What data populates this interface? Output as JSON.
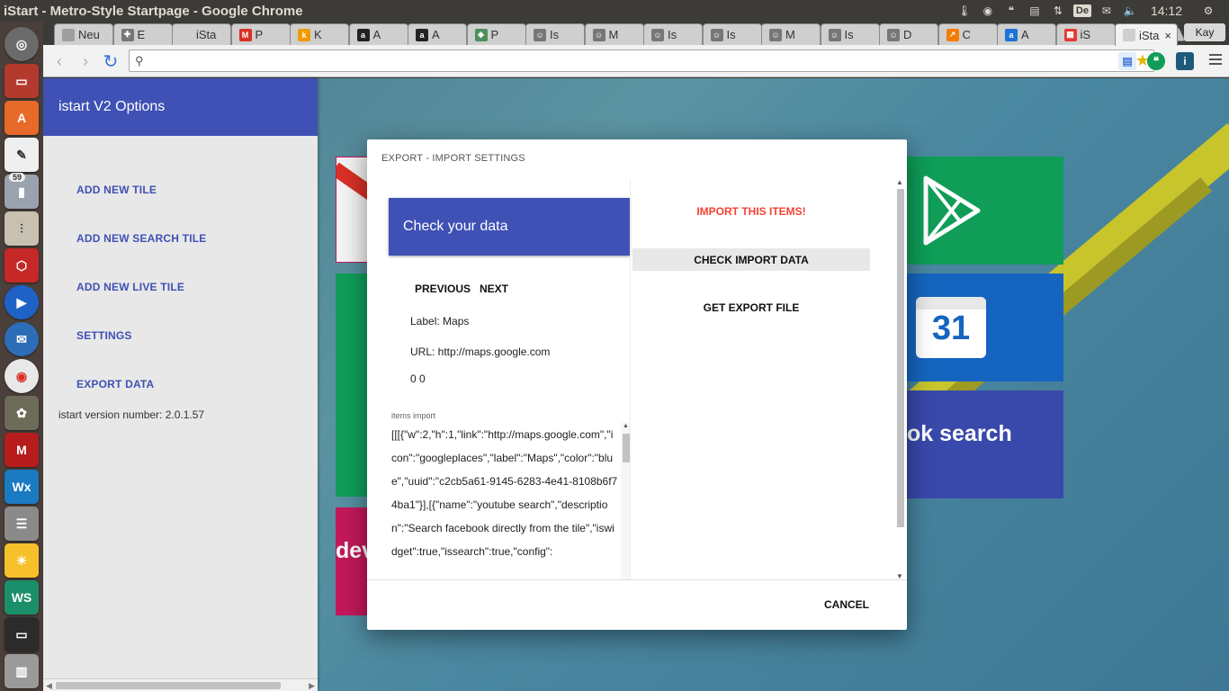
{
  "window": {
    "title": "iStart - Metro-Style Startpage - Google Chrome"
  },
  "tray": {
    "keyboard": "De",
    "time": "14:12"
  },
  "launcher": {
    "badge": "59"
  },
  "tabs": [
    {
      "label": "Neu",
      "fav_color": "#9e9e9e",
      "fav_glyph": ""
    },
    {
      "label": "E",
      "fav_color": "#777777",
      "fav_glyph": "✚"
    },
    {
      "label": "iSta",
      "fav_color": "#cfcfcf",
      "fav_glyph": ""
    },
    {
      "label": "P",
      "fav_color": "#d93025",
      "fav_glyph": "M"
    },
    {
      "label": "K",
      "fav_color": "#f29a00",
      "fav_glyph": "k"
    },
    {
      "label": "A",
      "fav_color": "#222222",
      "fav_glyph": "a"
    },
    {
      "label": "A",
      "fav_color": "#222222",
      "fav_glyph": "a"
    },
    {
      "label": "P",
      "fav_color": "#4b8f5a",
      "fav_glyph": "◈"
    },
    {
      "label": "Is",
      "fav_color": "#777777",
      "fav_glyph": "☺"
    },
    {
      "label": "M",
      "fav_color": "#777777",
      "fav_glyph": "☺"
    },
    {
      "label": "Is",
      "fav_color": "#777777",
      "fav_glyph": "☺"
    },
    {
      "label": "Is",
      "fav_color": "#777777",
      "fav_glyph": "☺"
    },
    {
      "label": "M",
      "fav_color": "#777777",
      "fav_glyph": "☺"
    },
    {
      "label": "Is",
      "fav_color": "#777777",
      "fav_glyph": "☺"
    },
    {
      "label": "D",
      "fav_color": "#777777",
      "fav_glyph": "☺"
    },
    {
      "label": "C",
      "fav_color": "#f57c00",
      "fav_glyph": "↗"
    },
    {
      "label": "A",
      "fav_color": "#1e73d8",
      "fav_glyph": "a"
    },
    {
      "label": "iS",
      "fav_color": "#e53935",
      "fav_glyph": "▦"
    },
    {
      "label": "iSta",
      "fav_color": "#cfcfcf",
      "fav_glyph": "",
      "active": true,
      "close": "×"
    }
  ],
  "profile": {
    "name": "Kay"
  },
  "toolbar": {
    "url": ""
  },
  "tiles": {
    "search_label": "ok search",
    "dev_label": "dev",
    "calendar_number": "31"
  },
  "sidebar": {
    "title": "istart V2 Options",
    "items": [
      "ADD NEW TILE",
      "ADD NEW SEARCH TILE",
      "ADD NEW LIVE TILE",
      "SETTINGS",
      "EXPORT DATA"
    ],
    "version": "istart version number: 2.0.1.57"
  },
  "dialog": {
    "title": "EXPORT - IMPORT SETTINGS",
    "check_title": "Check your data",
    "previous": "PREVIOUS",
    "next": "NEXT",
    "label_line": "Label: Maps",
    "url_line": "URL: http://maps.google.com",
    "pos_line": "0 0",
    "textarea_label": "items import",
    "textarea_value": "[[[{\"w\":2,\"h\":1,\"link\":\"http://maps.google.com\",\"icon\":\"googleplaces\",\"label\":\"Maps\",\"color\":\"blue\",\"uuid\":\"c2cb5a61-9145-6283-4e41-8108b6f74ba1\"}],[{\"name\":\"youtube search\",\"description\":\"Search facebook directly from the tile\",\"iswidget\":true,\"issearch\":true,\"config\":",
    "import_button": "IMPORT THIS ITEMS!",
    "check_import_button": "CHECK IMPORT DATA",
    "export_button": "GET EXPORT FILE",
    "cancel_button": "CANCEL"
  },
  "colors": {
    "primary": "#3f51b5",
    "danger": "#f44336",
    "tile_green": "#0f9d58",
    "tile_blue": "#1565c0",
    "tile_indigo": "#3949ab",
    "tile_pink": "#c2185b"
  }
}
